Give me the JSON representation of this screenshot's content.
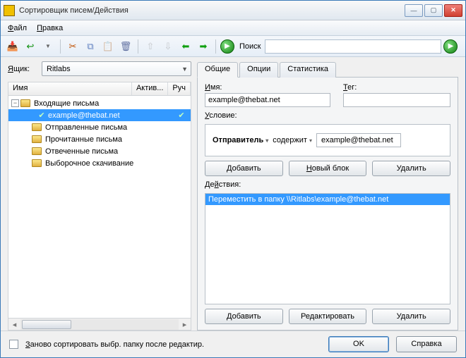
{
  "window": {
    "title": "Сортировщик писем/Действия"
  },
  "menu": {
    "file": "Файл",
    "edit": "Правка"
  },
  "toolbar": {
    "search_label": "Поиск",
    "search_value": ""
  },
  "box": {
    "label": "Ящик:",
    "value": "Ritlabs"
  },
  "tree": {
    "col_name": "Имя",
    "col_active": "Актив...",
    "col_manual": "Руч",
    "items": [
      {
        "label": "Входящие письма",
        "level": 1,
        "expandable": true,
        "expanded": true,
        "check": false
      },
      {
        "label": "example@thebat.net",
        "level": 2,
        "selected": true,
        "check": true
      },
      {
        "label": "Отправленные письма",
        "level": 1
      },
      {
        "label": "Прочитанные письма",
        "level": 1
      },
      {
        "label": "Отвеченные письма",
        "level": 1
      },
      {
        "label": "Выборочное скачивание",
        "level": 1
      }
    ]
  },
  "tabs": {
    "general": "Общие",
    "options": "Опции",
    "stats": "Статистика"
  },
  "form": {
    "name_label": "Имя:",
    "name_value": "example@thebat.net",
    "tag_label": "Тег:",
    "tag_value": "",
    "cond_label": "Условие:",
    "cond_field": "Отправитель",
    "cond_op": "содержит",
    "cond_value": "example@thebat.net",
    "add": "Добавить",
    "new_block": "Новый блок",
    "delete": "Удалить",
    "actions_label": "Действия:",
    "action_text": "Переместить в папку \\\\Ritlabs\\example@thebat.net",
    "edit": "Редактировать"
  },
  "bottom": {
    "resort": "Заново сортировать выбр. папку после редактир.",
    "ok": "OK",
    "help": "Справка"
  }
}
